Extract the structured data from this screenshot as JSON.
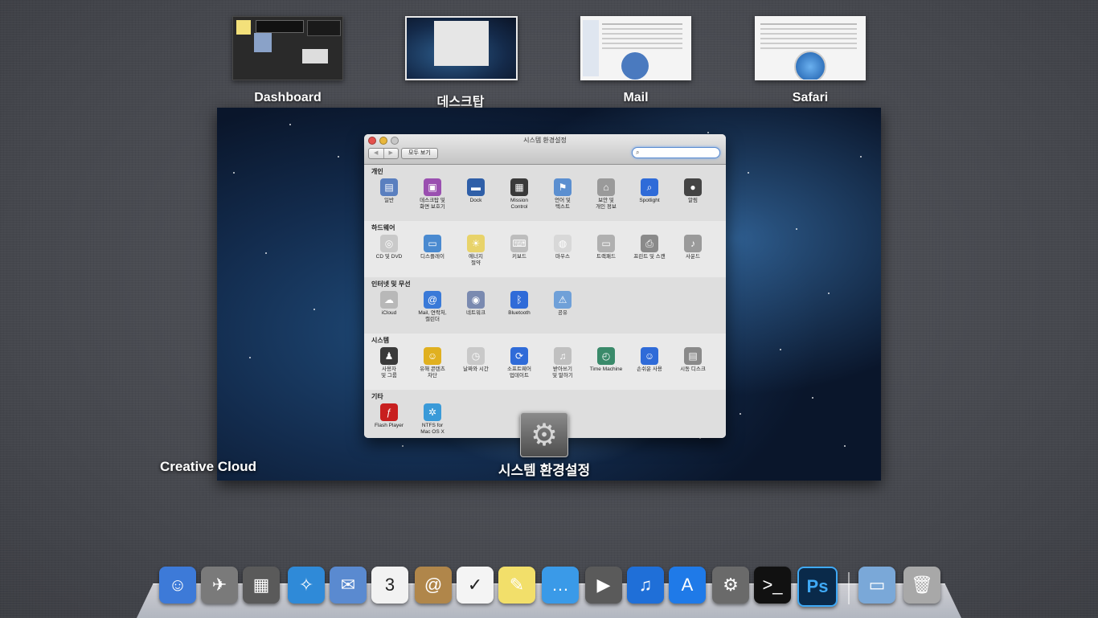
{
  "spaces": [
    {
      "label": "Dashboard"
    },
    {
      "label": "데스크탑"
    },
    {
      "label": "Mail"
    },
    {
      "label": "Safari"
    }
  ],
  "window": {
    "title": "시스템 환경설정",
    "show_all": "모두 보기",
    "search_placeholder": ""
  },
  "sections": [
    {
      "title": "개인",
      "items": [
        {
          "label": "일반",
          "icon": "general-icon",
          "color": "#5a7fbf",
          "glyph": "▤"
        },
        {
          "label": "데스크탑 및\n화면 보호기",
          "icon": "desktop-icon",
          "color": "#9a4fb0",
          "glyph": "▣"
        },
        {
          "label": "Dock",
          "icon": "dock-icon",
          "color": "#2f5fa8",
          "glyph": "▬"
        },
        {
          "label": "Mission\nControl",
          "icon": "mission-control-icon",
          "color": "#3a3a3a",
          "glyph": "▦"
        },
        {
          "label": "언어 및\n텍스트",
          "icon": "language-icon",
          "color": "#5b8fd0",
          "glyph": "⚑"
        },
        {
          "label": "보안 및\n개인 정보",
          "icon": "security-icon",
          "color": "#9a9a9a",
          "glyph": "⌂"
        },
        {
          "label": "Spotlight",
          "icon": "spotlight-icon",
          "color": "#2f6bd8",
          "glyph": "⌕"
        },
        {
          "label": "알림",
          "icon": "notifications-icon",
          "color": "#444",
          "glyph": "●"
        }
      ]
    },
    {
      "title": "하드웨어",
      "items": [
        {
          "label": "CD 및 DVD",
          "icon": "cd-icon",
          "color": "#c9c9c9",
          "glyph": "◎"
        },
        {
          "label": "디스플레이",
          "icon": "display-icon",
          "color": "#4a8ad0",
          "glyph": "▭"
        },
        {
          "label": "에너지\n절약",
          "icon": "energy-icon",
          "color": "#e8d36a",
          "glyph": "☀"
        },
        {
          "label": "키보드",
          "icon": "keyboard-icon",
          "color": "#bdbdbd",
          "glyph": "⌨"
        },
        {
          "label": "마우스",
          "icon": "mouse-icon",
          "color": "#d8d8d8",
          "glyph": "◍"
        },
        {
          "label": "트랙패드",
          "icon": "trackpad-icon",
          "color": "#b0b0b0",
          "glyph": "▭"
        },
        {
          "label": "프린트 및 스캔",
          "icon": "printer-icon",
          "color": "#8a8a8a",
          "glyph": "⎙"
        },
        {
          "label": "사운드",
          "icon": "sound-icon",
          "color": "#9a9a9a",
          "glyph": "♪"
        }
      ]
    },
    {
      "title": "인터넷 및 무선",
      "items": [
        {
          "label": "iCloud",
          "icon": "icloud-icon",
          "color": "#b8b8b8",
          "glyph": "☁"
        },
        {
          "label": "Mail, 연락처,\n캘린더",
          "icon": "mail-contacts-icon",
          "color": "#3a7ad8",
          "glyph": "@"
        },
        {
          "label": "네트워크",
          "icon": "network-icon",
          "color": "#7a8ab0",
          "glyph": "◉"
        },
        {
          "label": "Bluetooth",
          "icon": "bluetooth-icon",
          "color": "#2f6bd8",
          "glyph": "ᛒ"
        },
        {
          "label": "공유",
          "icon": "sharing-icon",
          "color": "#6fa0d8",
          "glyph": "⚠"
        }
      ]
    },
    {
      "title": "시스템",
      "items": [
        {
          "label": "사용자\n및 그룹",
          "icon": "users-icon",
          "color": "#3a3a3a",
          "glyph": "♟"
        },
        {
          "label": "유해 콘텐츠\n차단",
          "icon": "parental-controls-icon",
          "color": "#e0b020",
          "glyph": "☺"
        },
        {
          "label": "날짜와 시간",
          "icon": "date-time-icon",
          "color": "#c9c9c9",
          "glyph": "◷"
        },
        {
          "label": "소프트웨어\n업데이트",
          "icon": "software-update-icon",
          "color": "#2f6bd8",
          "glyph": "⟳"
        },
        {
          "label": "받아쓰기\n및 말하기",
          "icon": "dictation-icon",
          "color": "#c0c0c0",
          "glyph": "♫"
        },
        {
          "label": "Time Machine",
          "icon": "time-machine-icon",
          "color": "#3a8a6a",
          "glyph": "◴"
        },
        {
          "label": "손쉬운 사용",
          "icon": "accessibility-icon",
          "color": "#2f6bd8",
          "glyph": "☺"
        },
        {
          "label": "시동 디스크",
          "icon": "startup-disk-icon",
          "color": "#8a8a8a",
          "glyph": "▤"
        }
      ]
    },
    {
      "title": "기타",
      "items": [
        {
          "label": "Flash Player",
          "icon": "flash-player-icon",
          "color": "#c81f1f",
          "glyph": "ƒ"
        },
        {
          "label": "NTFS for\nMac OS X",
          "icon": "ntfs-icon",
          "color": "#3a9ad8",
          "glyph": "✲"
        }
      ]
    }
  ],
  "captions": {
    "left": "Creative Cloud",
    "center": "시스템 환경설정"
  },
  "dock": [
    {
      "name": "finder-icon",
      "color": "#3d7ad8",
      "glyph": "☺"
    },
    {
      "name": "launchpad-icon",
      "color": "#7a7a7a",
      "glyph": "✈"
    },
    {
      "name": "mission-control-dock-icon",
      "color": "#5a5a5a",
      "glyph": "▦"
    },
    {
      "name": "safari-icon",
      "color": "#2f8ad8",
      "glyph": "✧"
    },
    {
      "name": "mail-icon",
      "color": "#5a8ad0",
      "glyph": "✉"
    },
    {
      "name": "calendar-icon",
      "color": "#f2f2f2",
      "glyph": "3"
    },
    {
      "name": "contacts-icon",
      "color": "#b0864a",
      "glyph": "@"
    },
    {
      "name": "reminders-icon",
      "color": "#f4f4f4",
      "glyph": "✓"
    },
    {
      "name": "notes-icon",
      "color": "#f2df6a",
      "glyph": "✎"
    },
    {
      "name": "messages-icon",
      "color": "#3a9ae8",
      "glyph": "…"
    },
    {
      "name": "facetime-icon",
      "color": "#5a5a5a",
      "glyph": "▶"
    },
    {
      "name": "itunes-icon",
      "color": "#1f6fd8",
      "glyph": "♫"
    },
    {
      "name": "app-store-icon",
      "color": "#1f7ae8",
      "glyph": "A"
    },
    {
      "name": "system-preferences-icon",
      "color": "#6a6a6a",
      "glyph": "⚙"
    },
    {
      "name": "terminal-icon",
      "color": "#111111",
      "glyph": ">_"
    },
    {
      "name": "photoshop-icon",
      "color": "#0a2a4a",
      "glyph": "Ps"
    },
    {
      "name": "folder-icon",
      "color": "#7aa8d8",
      "glyph": "▭"
    },
    {
      "name": "trash-icon",
      "color": "#a8a8a8",
      "glyph": "🗑"
    }
  ]
}
